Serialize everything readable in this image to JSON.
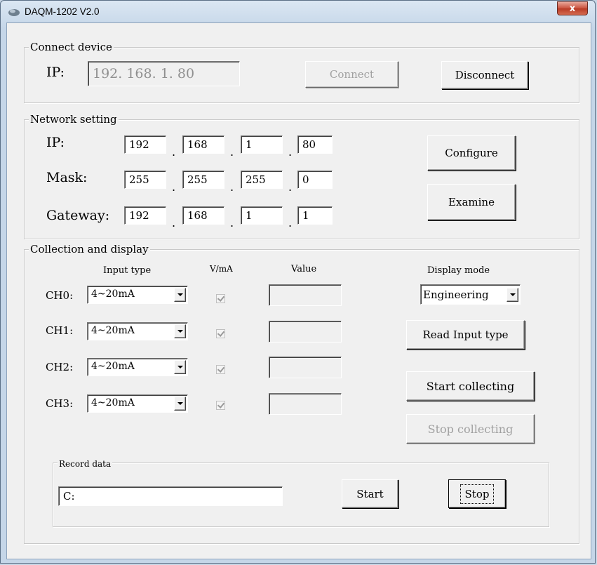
{
  "window": {
    "title": "DAQM-1202  V2.0",
    "close": "x"
  },
  "connect": {
    "legend": "Connect device",
    "ip_label": "IP:",
    "ip_value": "192. 168. 1. 80",
    "connect_btn": "Connect",
    "disconnect_btn": "Disconnect"
  },
  "network": {
    "legend": "Network setting",
    "ip_label": "IP:",
    "ip": [
      "192",
      "168",
      "1",
      "80"
    ],
    "mask_label": "Mask:",
    "mask": [
      "255",
      "255",
      "255",
      "0"
    ],
    "gateway_label": "Gateway:",
    "gateway": [
      "192",
      "168",
      "1",
      "1"
    ],
    "dot": ".",
    "configure_btn": "Configure",
    "examine_btn": "Examine"
  },
  "collection": {
    "legend": "Collection and display",
    "col_input_type": "Input type",
    "col_vma": "V/mA",
    "col_value": "Value",
    "display_mode_label": "Display mode",
    "display_mode": "Engineering",
    "channels": [
      {
        "label": "CH0:",
        "type": "4~20mA",
        "value": ""
      },
      {
        "label": "CH1:",
        "type": "4~20mA",
        "value": ""
      },
      {
        "label": "CH2:",
        "type": "4~20mA",
        "value": ""
      },
      {
        "label": "CH3:",
        "type": "4~20mA",
        "value": ""
      }
    ],
    "read_input_btn": "Read Input type",
    "start_collecting_btn": "Start collecting",
    "stop_collecting_btn": "Stop collecting"
  },
  "record": {
    "legend": "Record data",
    "path": "C:",
    "start_btn": "Start",
    "stop_btn": "Stop"
  }
}
